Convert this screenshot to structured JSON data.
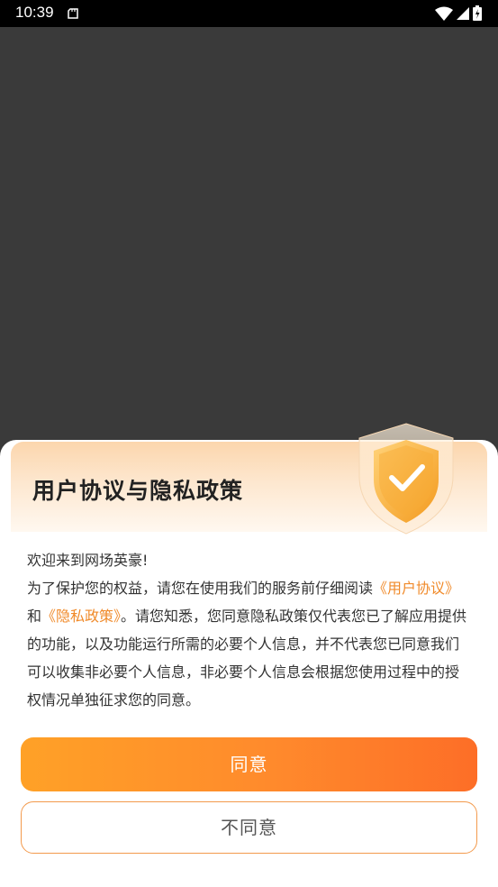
{
  "status_bar": {
    "time": "10:39"
  },
  "dialog": {
    "title": "用户协议与隐私政策",
    "welcome": "欢迎来到网场英豪!",
    "intro": "为了保护您的权益，请您在使用我们的服务前仔细阅读",
    "user_agreement_link": "《用户协议》",
    "and": "和",
    "privacy_policy_link": "《隐私政策》",
    "notice": "。请您知悉，您同意隐私政策仅代表您已了解应用提供的功能，以及功能运行所需的必要个人信息，并不代表您已同意我们可以收集非必要个人信息，非必要个人信息会根据您使用过程中的授权情况单独征求您的同意。",
    "agree_label": "同意",
    "disagree_label": "不同意"
  },
  "colors": {
    "accent": "#ff8a2c",
    "link": "#f08a2a",
    "backdrop": "#3a3a3a"
  },
  "icons": {
    "status": [
      "notification-icon",
      "wifi-icon",
      "signal-icon",
      "battery-icon"
    ],
    "header": "shield-check-icon"
  }
}
